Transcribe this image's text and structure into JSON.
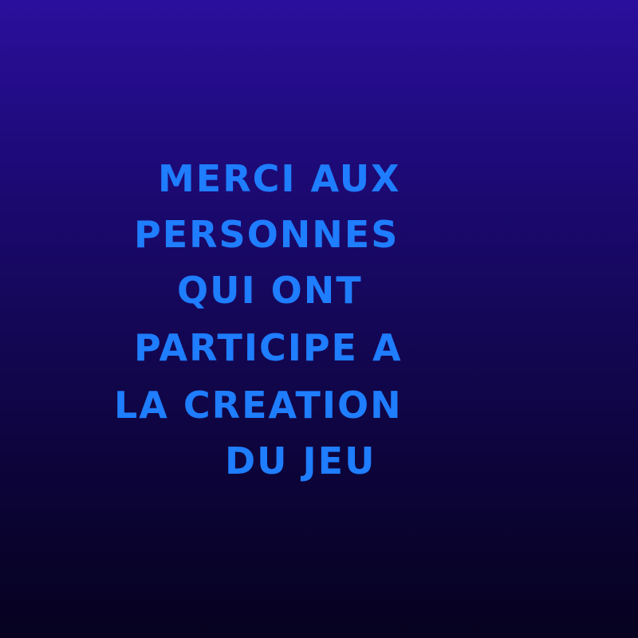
{
  "screen": {
    "background_top": "#2a0f9c",
    "background_bottom": "#06021f",
    "text_color": "#1f7dff"
  },
  "credits": {
    "lines": [
      "MERCI AUX",
      "PERSONNES",
      "QUI ONT",
      "PARTICIPE A",
      "LA CREATION",
      "DU JEU"
    ]
  }
}
